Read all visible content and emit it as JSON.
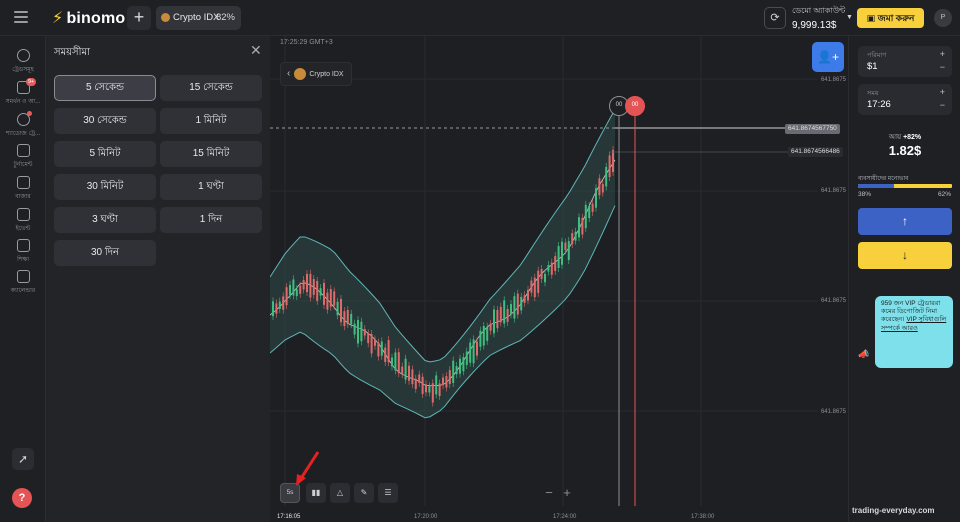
{
  "header": {
    "logo": "binomo",
    "asset_tab": {
      "name": "Crypto IDX",
      "payout": "82%"
    },
    "account": {
      "label": "ডেমো অ্যাকাউন্ট",
      "balance": "9,999.13$"
    },
    "deposit_label": "জমা করুন",
    "avatar_letter": "P"
  },
  "leftnav": {
    "items": [
      {
        "label": "ট্রেডসমূহ",
        "icon": "clock-icon"
      },
      {
        "label": "সমর্থন ও আ...",
        "icon": "chat-icon",
        "badge": "9+"
      },
      {
        "label": "শ্যাডোজ ট্রে...",
        "icon": "users-icon"
      },
      {
        "label": "টুর্নামেন্ট",
        "icon": "trophy-icon"
      },
      {
        "label": "বাজার",
        "icon": "store-icon"
      },
      {
        "label": "ইভেন্ট",
        "icon": "video-icon"
      },
      {
        "label": "শিক্ষা",
        "icon": "graduation-icon"
      },
      {
        "label": "ক্যালেন্ডার",
        "icon": "calendar-icon"
      }
    ]
  },
  "time_panel": {
    "title": "সময়সীমা",
    "options": [
      "5 সেকেন্ড",
      "15 সেকেন্ড",
      "30 সেকেন্ড",
      "1 মিনিট",
      "5 মিনিট",
      "15 মিনিট",
      "30 মিনিট",
      "1 ঘণ্টা",
      "3 ঘণ্টা",
      "1 দিন",
      "30 দিন"
    ],
    "selected": "5 সেকেন্ড"
  },
  "chart": {
    "clock": "17:25:29 GMT+3",
    "asset": "Crypto IDX",
    "price_labels": [
      "641.8675",
      "641.8675",
      "641.8675",
      "641.8675",
      "641.8675"
    ],
    "current_price": "641.8674567750",
    "secondary_price": "641.8674566486",
    "time_labels": [
      "17:16:05",
      "17:20:00",
      "17:24:00",
      "17:38:00"
    ],
    "timeframe_btn": "5s",
    "countdown": "00",
    "countdown2": "00"
  },
  "chart_data": {
    "type": "candlestick",
    "x": [
      "17:16:05",
      "17:20:00",
      "17:24:00",
      "17:38:00"
    ],
    "series": [
      {
        "name": "",
        "values": [
          0.4,
          0.46,
          0.5,
          0.47,
          0.44,
          0.38,
          0.34,
          0.3,
          0.24,
          0.2,
          0.16,
          0.18,
          0.24,
          0.3,
          0.36,
          0.4,
          0.44,
          0.5,
          0.56,
          0.62,
          0.7,
          0.8,
          0.9
        ]
      }
    ]
  },
  "right_panel": {
    "amount": {
      "label": "পরিমাণ",
      "value": "$1"
    },
    "time": {
      "label": "সময়",
      "value": "17:26"
    },
    "payout_label": "আয়",
    "payout_pct": "+82%",
    "payout_value": "1.82$",
    "sentiment_label": "ব্যবসায়ীদের মনোভাব",
    "up_pct": "38%",
    "down_pct": "62%",
    "up_share": 38,
    "vip": {
      "text": "959 জন VIP ট্রেডাররা কমের ডিপোজিট নিমা করেছেন।",
      "link": "VIP সুবিধাগুলি সম্পর্কে আরও"
    }
  },
  "watermark": "trading-everyday.com"
}
